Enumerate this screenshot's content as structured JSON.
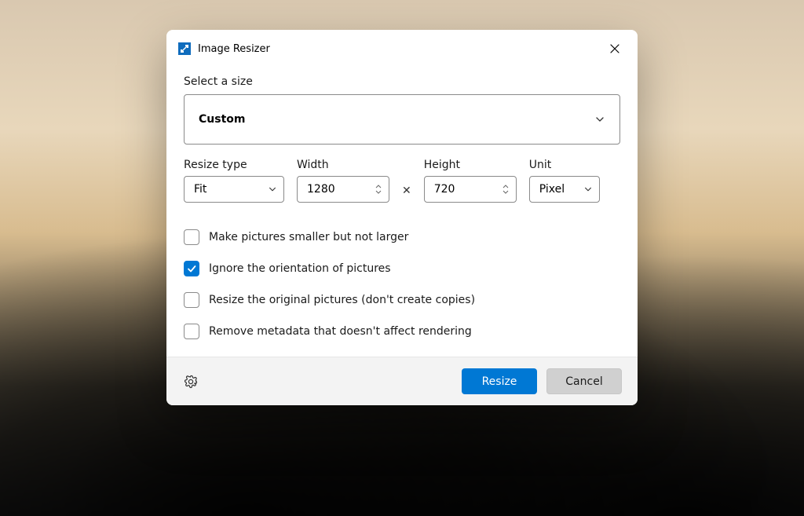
{
  "window": {
    "title": "Image Resizer"
  },
  "labels": {
    "select_size": "Select a size",
    "resize_type": "Resize type",
    "width": "Width",
    "height": "Height",
    "unit": "Unit",
    "times": "✕"
  },
  "size_preset": {
    "selected": "Custom"
  },
  "resize_type": {
    "selected": "Fit"
  },
  "width": {
    "value": "1280"
  },
  "height": {
    "value": "720"
  },
  "unit": {
    "selected": "Pixel"
  },
  "options": {
    "smaller_not_larger": {
      "label": "Make pictures smaller but not larger",
      "checked": false
    },
    "ignore_orientation": {
      "label": "Ignore the orientation of pictures",
      "checked": true
    },
    "resize_originals": {
      "label": "Resize the original pictures (don't create copies)",
      "checked": false
    },
    "remove_metadata": {
      "label": "Remove metadata that doesn't affect rendering",
      "checked": false
    }
  },
  "buttons": {
    "resize": "Resize",
    "cancel": "Cancel"
  }
}
